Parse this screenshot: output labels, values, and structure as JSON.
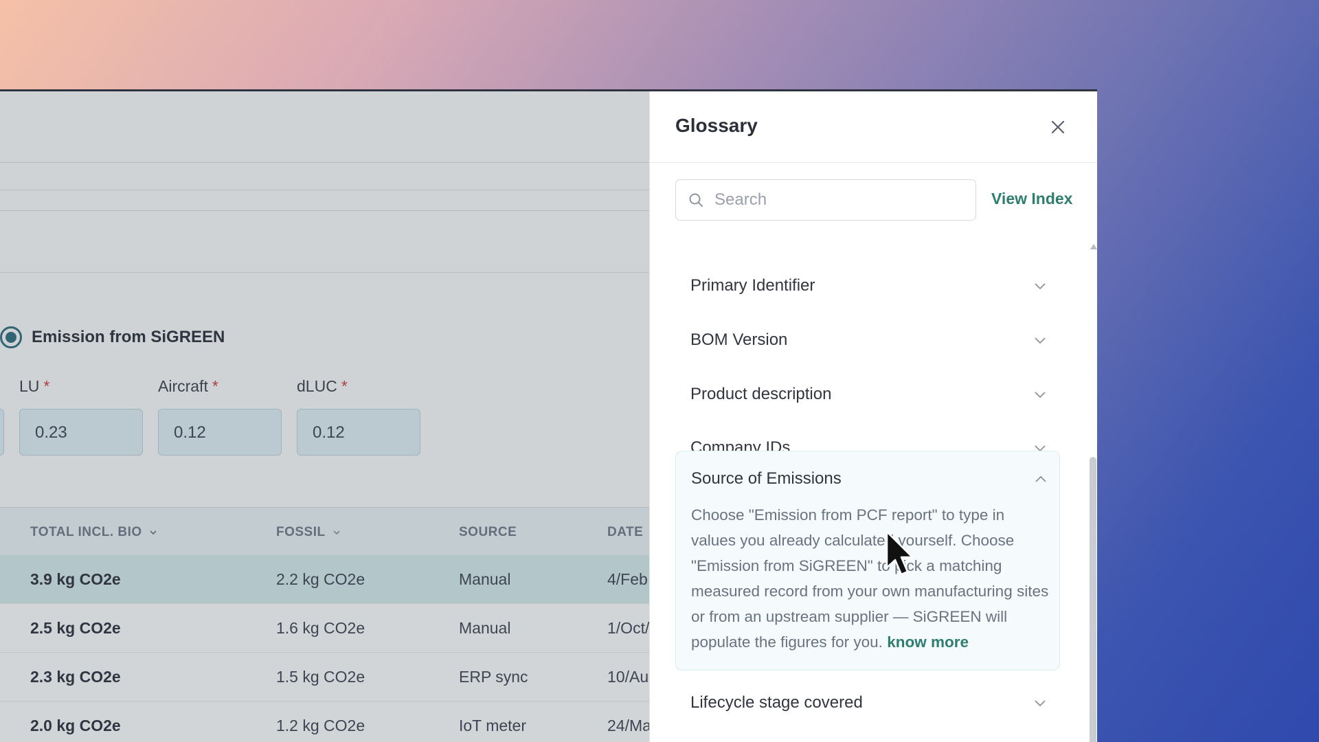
{
  "background": {
    "radio": {
      "label": "Emission from SiGREEN",
      "selected": true
    },
    "fields": [
      {
        "label": "LU",
        "value": "0.23"
      },
      {
        "label": "Aircraft",
        "value": "0.12"
      },
      {
        "label": "dLUC",
        "value": "0.12"
      }
    ],
    "required_marker": "*",
    "table": {
      "columns": [
        "TOTAL INCL. BIO",
        "FOSSIL",
        "SOURCE",
        "DATE"
      ],
      "rows": [
        [
          "3.9 kg CO2e",
          "2.2 kg CO2e",
          "Manual",
          "4/Feb"
        ],
        [
          "2.5 kg CO2e",
          "1.6 kg CO2e",
          "Manual",
          "1/Oct/"
        ],
        [
          "2.3 kg CO2e",
          "1.5 kg CO2e",
          "ERP sync",
          "10/Au"
        ],
        [
          "2.0 kg CO2e",
          "1.2 kg CO2e",
          "IoT meter",
          "24/Ma"
        ]
      ]
    }
  },
  "glossary": {
    "title": "Glossary",
    "search_placeholder": "Search",
    "view_index_label": "View Index",
    "items": [
      {
        "title": "Primary Identifier",
        "expanded": false
      },
      {
        "title": "BOM Version",
        "expanded": false
      },
      {
        "title": "Product description",
        "expanded": false
      },
      {
        "title": "Company IDs",
        "expanded": false
      }
    ],
    "expanded_item": {
      "title": "Source of Emissions",
      "body": "Choose \"Emission from PCF report\" to type in values you already calculated yourself. Choose \"Emission from SiGREEN\" to pick a matching measured record from your own manufacturing sites or from an upstream supplier — SiGREEN will populate the figures for you.",
      "link": "know more"
    },
    "last_item": {
      "title": "Lifecycle stage covered",
      "expanded": false
    }
  },
  "colors": {
    "accent": "#2e7d6f",
    "radio": "#2e6b78",
    "required": "#c53b3b",
    "highlight_row": "#cfe4e6"
  }
}
